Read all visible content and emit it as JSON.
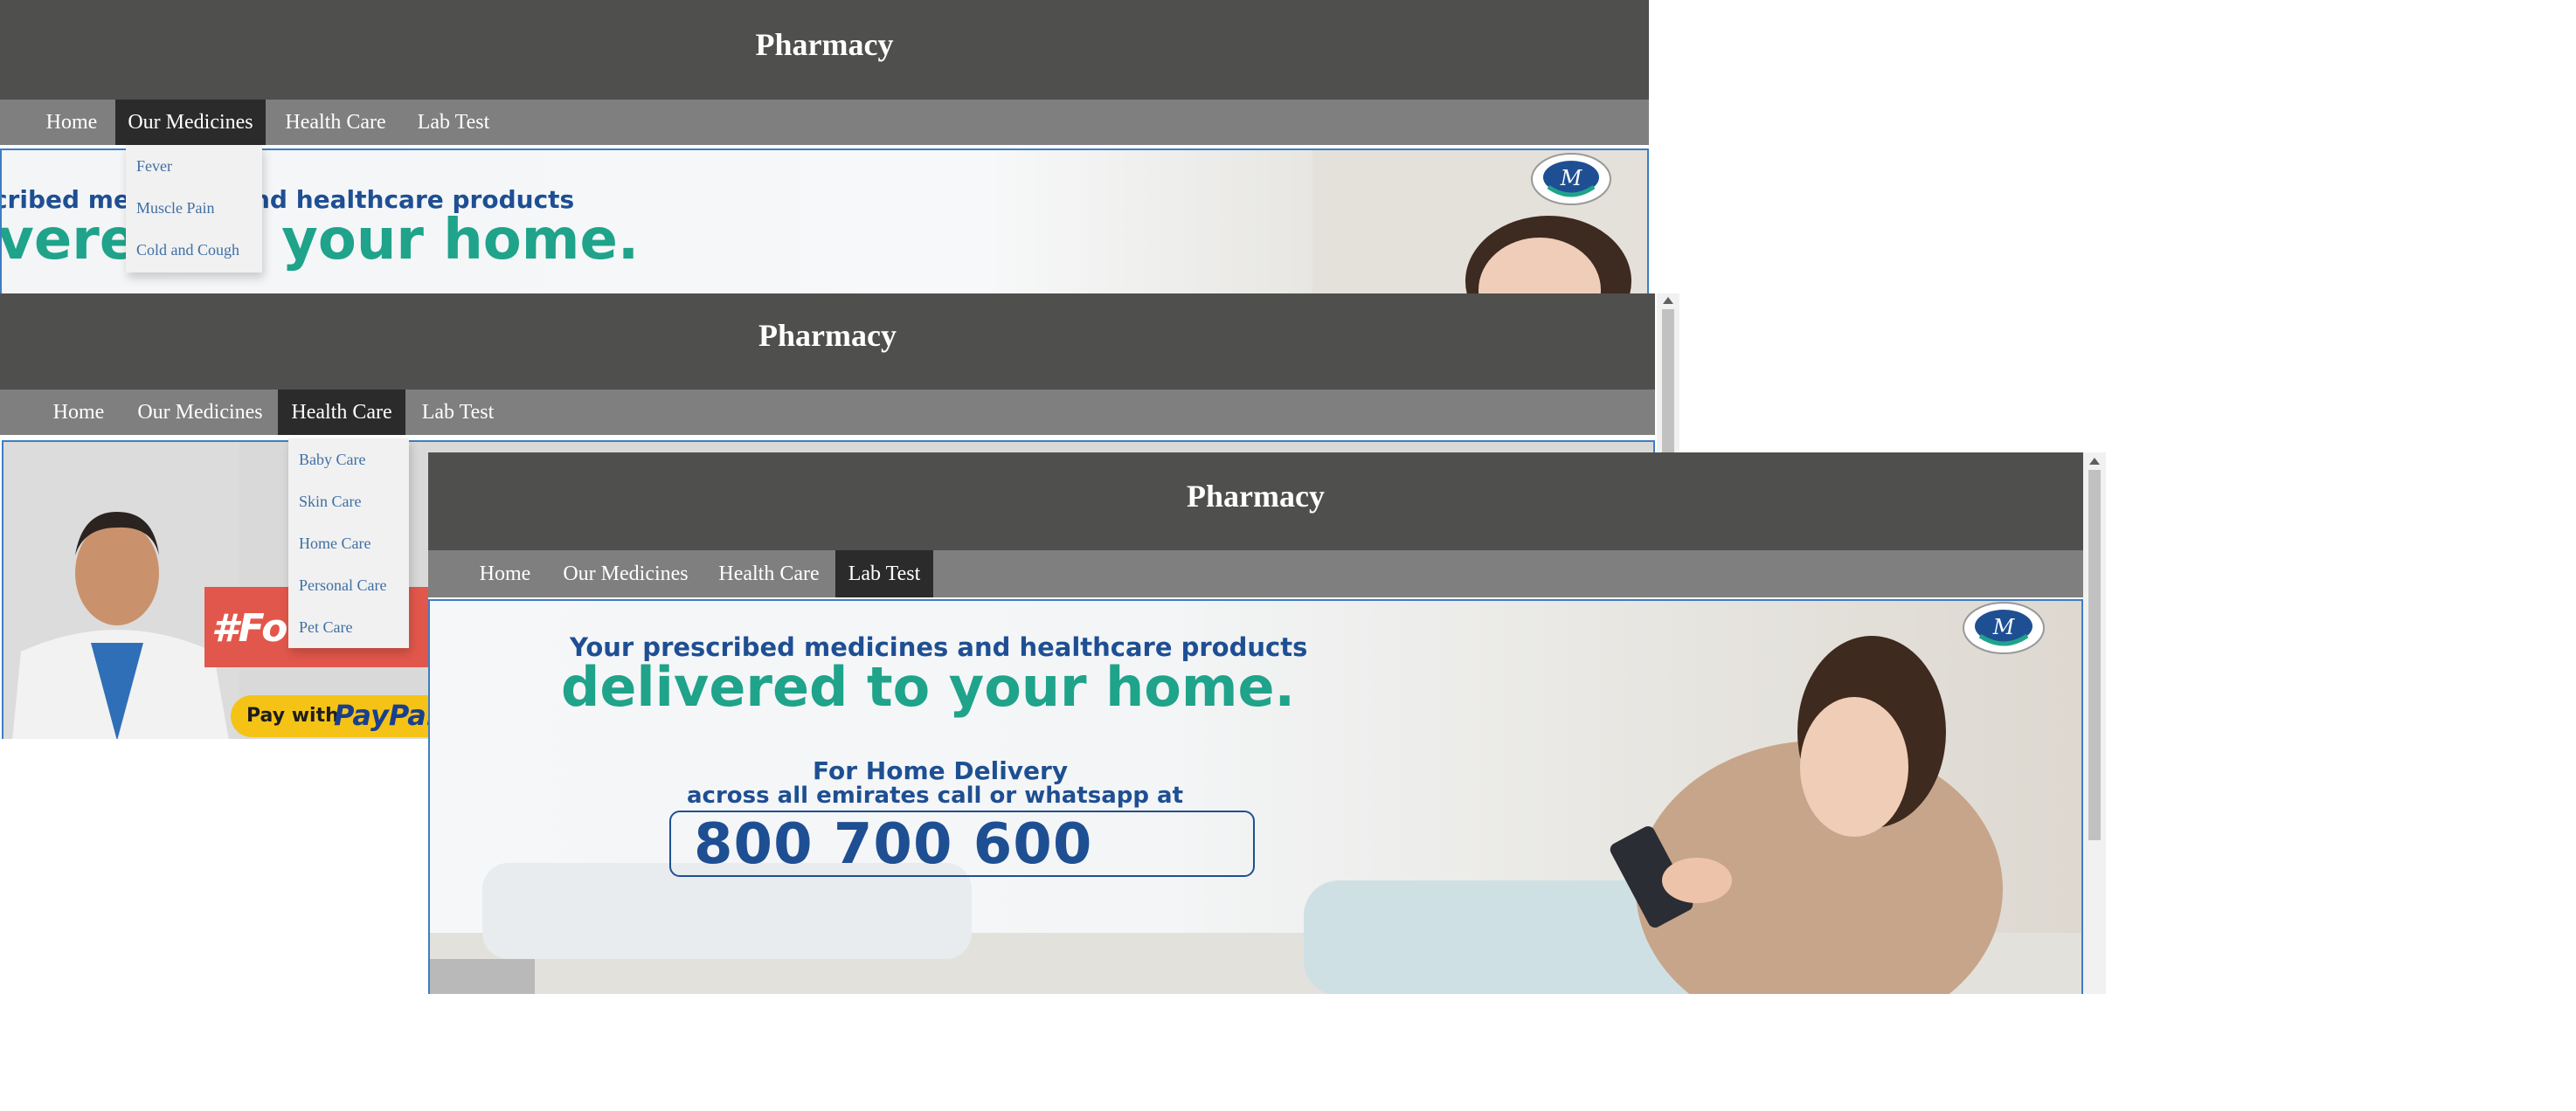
{
  "shot1": {
    "title": "Pharmacy",
    "nav": [
      "Home",
      "Our Medicines",
      "Health Care",
      "Lab Test"
    ],
    "dropdown": [
      "Fever",
      "Muscle Pain",
      "Cold and Cough"
    ],
    "banner": {
      "line1": "Your prescribed medicines and healthcare products",
      "line2": "delivered to your home."
    }
  },
  "shot2": {
    "title": "Pharmacy",
    "nav": [
      "Home",
      "Our Medicines",
      "Health Care",
      "Lab Test"
    ],
    "dropdown": [
      "Baby Care",
      "Skin Care",
      "Home Care",
      "Personal Care",
      "Pet Care"
    ],
    "banner": {
      "hashtag": "#For",
      "pay": "Pay with",
      "paypal": "PayPal"
    }
  },
  "shot3": {
    "title": "Pharmacy",
    "nav": [
      "Home",
      "Our Medicines",
      "Health Care",
      "Lab Test"
    ],
    "banner": {
      "line1": "Your prescribed medicines and healthcare products",
      "line2": "delivered to your home.",
      "line3": "For Home Delivery",
      "line4": "across all emirates call or whatsapp at",
      "phone": "800 700 600"
    }
  },
  "colors": {
    "header": "#4f4f4d",
    "nav": "#7f7f7f",
    "active": "#2b2b2b",
    "link": "#3f6fa4",
    "banner_blue": "#1e4f93",
    "banner_green": "#1fa38a"
  },
  "icons": [
    "m-logo-icon",
    "scroll-up-arrow-icon"
  ]
}
